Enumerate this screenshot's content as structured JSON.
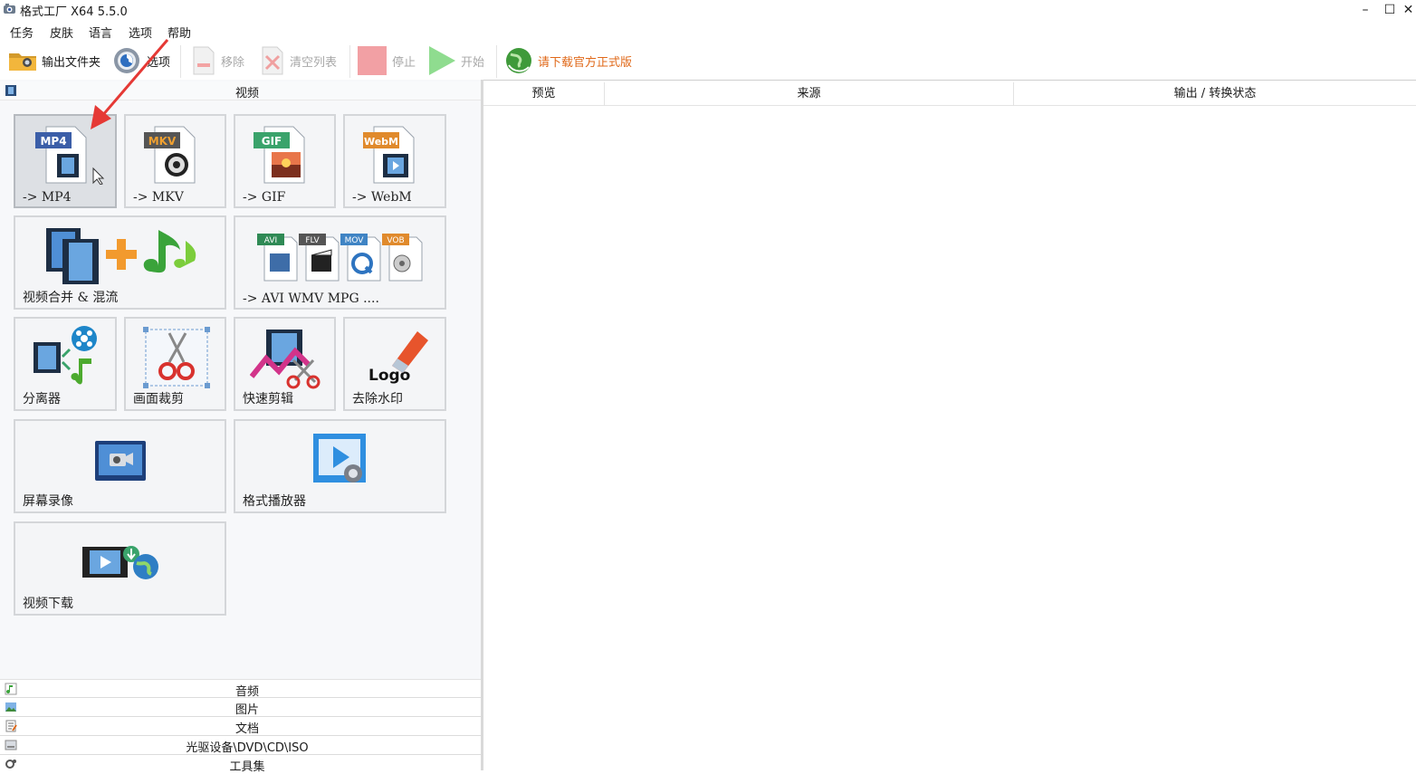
{
  "window": {
    "title": "格式工厂 X64 5.5.0",
    "minimize": "–",
    "maximize": "☐",
    "close": "✕"
  },
  "menu": [
    "任务",
    "皮肤",
    "语言",
    "选项",
    "帮助"
  ],
  "toolbar": {
    "output_folder": "输出文件夹",
    "options": "选项",
    "remove": "移除",
    "clear_list": "清空列表",
    "stop": "停止",
    "start": "开始",
    "download_official": "请下载官方正式版"
  },
  "categories": {
    "video": "视频",
    "audio": "音频",
    "image": "图片",
    "document": "文档",
    "disc": "光驱设备\\DVD\\CD\\ISO",
    "tools": "工具集"
  },
  "video_tiles": {
    "mp4": {
      "label": "-> MP4",
      "badge": "MP4",
      "badge_color": "#3b5ea8"
    },
    "mkv": {
      "label": "-> MKV",
      "badge": "MKV",
      "badge_color": "#5a5a5a"
    },
    "gif": {
      "label": "-> GIF",
      "badge": "GIF",
      "badge_color": "#3aa36b"
    },
    "webm": {
      "label": "-> WebM",
      "badge": "WebM",
      "badge_color": "#e08a2c"
    },
    "merge": {
      "label": "视频合并 & 混流"
    },
    "others": {
      "label": "-> AVI WMV MPG ....",
      "badges": [
        "AVI",
        "FLV",
        "MOV",
        "VOB"
      ]
    },
    "splitter": {
      "label": "分离器"
    },
    "crop": {
      "label": "画面裁剪"
    },
    "quick_edit": {
      "label": "快速剪辑"
    },
    "watermark": {
      "label": "去除水印",
      "logo_text": "Logo"
    },
    "screen_record": {
      "label": "屏幕录像"
    },
    "player": {
      "label": "格式播放器"
    },
    "download": {
      "label": "视频下载"
    }
  },
  "list_columns": [
    "预览",
    "来源",
    "输出 / 转换状态"
  ],
  "colors": {
    "accent_orange": "#e0691a",
    "annotation_red": "#e53935"
  }
}
